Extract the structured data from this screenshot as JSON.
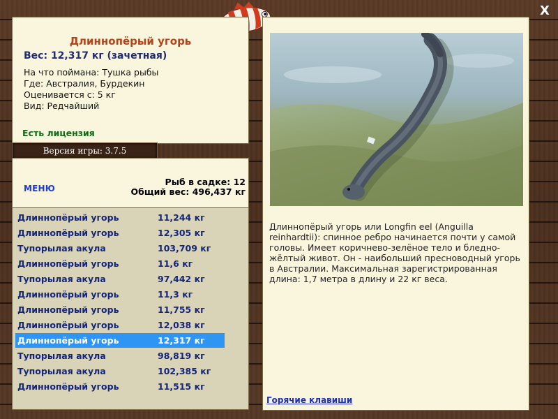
{
  "header": {
    "close_label": "X"
  },
  "info": {
    "title": "Длиннопёрый угорь",
    "weight": "Вес: 12,317 кг (зачетная)",
    "bait": "На что поймана: Тушка рыбы",
    "location": "Где: Австралия, Бурдекин",
    "value": "Оценивается с: 5 кг",
    "rarity": "Вид: Редчайший",
    "license": "Есть лицензия"
  },
  "version": "Версия игры: 3.7.5",
  "summary": {
    "menu_label": "МЕНЮ",
    "fish_in_keepnet": "Рыб в садке: 12",
    "total_weight": "Общий вес: 496,437 кг"
  },
  "catches": [
    {
      "name": "Длиннопёрый угорь",
      "weight": "11,244 кг"
    },
    {
      "name": "Длиннопёрый угорь",
      "weight": "12,305 кг"
    },
    {
      "name": "Тупорылая акула",
      "weight": "103,709 кг"
    },
    {
      "name": "Длиннопёрый угорь",
      "weight": "11,6 кг"
    },
    {
      "name": "Тупорылая акула",
      "weight": "97,442 кг"
    },
    {
      "name": "Длиннопёрый угорь",
      "weight": "11,3 кг"
    },
    {
      "name": "Длиннопёрый угорь",
      "weight": "11,755 кг"
    },
    {
      "name": "Длиннопёрый угорь",
      "weight": "12,038 кг"
    },
    {
      "name": "Длиннопёрый угорь",
      "weight": "12,317 кг"
    },
    {
      "name": "Тупорылая акула",
      "weight": "98,819 кг"
    },
    {
      "name": "Тупорылая акула",
      "weight": "102,385 кг"
    },
    {
      "name": "Длиннопёрый угорь",
      "weight": "11,515 кг"
    }
  ],
  "selected_index": 8,
  "description": "Длиннопёрый угорь или Longfin eel (Anguilla reinhardtii): спинное ребро начинается почти у самой головы. Имеет коричнево-зелёное тело и бледно-жёлтый живот. Он - наибольший пресноводный угорь в Австралии. Максимальная зарегистрированная длина: 1,7 метра в длину и 22 кг веса.",
  "hotkeys_label": "Горячие клавиши",
  "colors": {
    "accent_title": "#b5431a",
    "list_text": "#14267a",
    "selection": "#2f95f5",
    "license": "#0e6b12"
  }
}
